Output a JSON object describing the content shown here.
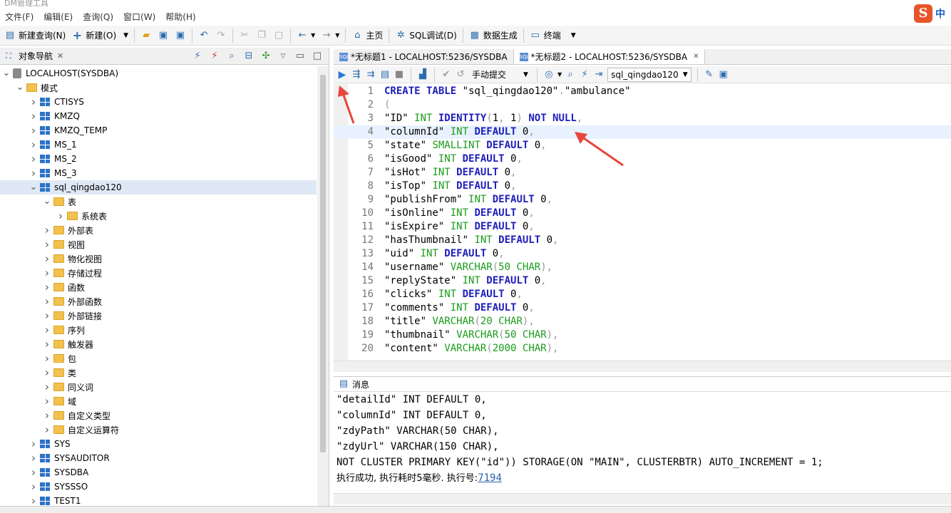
{
  "app": {
    "title": "DM管理工具"
  },
  "menu": [
    "文件(F)",
    "编辑(E)",
    "查询(Q)",
    "窗口(W)",
    "帮助(H)"
  ],
  "ime": {
    "logo": "S",
    "lang": "中"
  },
  "toolbar": {
    "new_query": "新建查询(N)",
    "new": "新建(O)",
    "home": "主页",
    "sql_debug": "SQL调试(D)",
    "data_gen": "数据生成",
    "terminal": "终端"
  },
  "navigator": {
    "title": "对象导航",
    "tree": [
      {
        "label": "LOCALHOST(SYSDBA)",
        "level": 0,
        "icon": "server-icon",
        "expanded": true
      },
      {
        "label": "模式",
        "level": 1,
        "icon": "folder-icon",
        "expanded": true
      },
      {
        "label": "CTISYS",
        "level": 2,
        "icon": "schema-icon",
        "expanded": false
      },
      {
        "label": "KMZQ",
        "level": 2,
        "icon": "schema-icon",
        "expanded": false
      },
      {
        "label": "KMZQ_TEMP",
        "level": 2,
        "icon": "schema-icon",
        "expanded": false
      },
      {
        "label": "MS_1",
        "level": 2,
        "icon": "schema-icon",
        "expanded": false
      },
      {
        "label": "MS_2",
        "level": 2,
        "icon": "schema-icon",
        "expanded": false
      },
      {
        "label": "MS_3",
        "level": 2,
        "icon": "schema-icon",
        "expanded": false
      },
      {
        "label": "sql_qingdao120",
        "level": 2,
        "icon": "schema-icon",
        "expanded": true,
        "selected": true
      },
      {
        "label": "表",
        "level": 3,
        "icon": "folder-icon",
        "expanded": true
      },
      {
        "label": "系统表",
        "level": 4,
        "icon": "folder-icon",
        "expanded": false
      },
      {
        "label": "外部表",
        "level": 3,
        "icon": "folder-icon",
        "expanded": false
      },
      {
        "label": "视图",
        "level": 3,
        "icon": "folder-icon",
        "expanded": false
      },
      {
        "label": "物化视图",
        "level": 3,
        "icon": "folder-icon",
        "expanded": false
      },
      {
        "label": "存储过程",
        "level": 3,
        "icon": "folder-icon",
        "expanded": false
      },
      {
        "label": "函数",
        "level": 3,
        "icon": "folder-icon",
        "expanded": false
      },
      {
        "label": "外部函数",
        "level": 3,
        "icon": "folder-icon",
        "expanded": false
      },
      {
        "label": "外部链接",
        "level": 3,
        "icon": "folder-icon",
        "expanded": false
      },
      {
        "label": "序列",
        "level": 3,
        "icon": "folder-icon",
        "expanded": false
      },
      {
        "label": "触发器",
        "level": 3,
        "icon": "folder-icon",
        "expanded": false
      },
      {
        "label": "包",
        "level": 3,
        "icon": "folder-icon",
        "expanded": false
      },
      {
        "label": "类",
        "level": 3,
        "icon": "folder-icon",
        "expanded": false
      },
      {
        "label": "同义词",
        "level": 3,
        "icon": "folder-icon",
        "expanded": false
      },
      {
        "label": "域",
        "level": 3,
        "icon": "folder-icon",
        "expanded": false
      },
      {
        "label": "自定义类型",
        "level": 3,
        "icon": "folder-icon",
        "expanded": false
      },
      {
        "label": "自定义运算符",
        "level": 3,
        "icon": "folder-icon",
        "expanded": false
      },
      {
        "label": "SYS",
        "level": 2,
        "icon": "schema-icon",
        "expanded": false
      },
      {
        "label": "SYSAUDITOR",
        "level": 2,
        "icon": "schema-icon",
        "expanded": false
      },
      {
        "label": "SYSDBA",
        "level": 2,
        "icon": "schema-icon",
        "expanded": false
      },
      {
        "label": "SYSSSO",
        "level": 2,
        "icon": "schema-icon",
        "expanded": false
      },
      {
        "label": "TEST1",
        "level": 2,
        "icon": "schema-icon",
        "expanded": false
      }
    ]
  },
  "tabs": [
    {
      "label": "*无标题1 - LOCALHOST:5236/SYSDBA",
      "active": false
    },
    {
      "label": "*无标题2 - LOCALHOST:5236/SYSDBA",
      "active": true
    }
  ],
  "editor_toolbar": {
    "commit_mode": "手动提交",
    "schema": "sql_qingdao120"
  },
  "editor": {
    "current_line": 4,
    "lines": [
      {
        "n": "1",
        "parts": [
          [
            "kw",
            "CREATE TABLE "
          ],
          [
            "tx",
            "\"sql_qingdao120\""
          ],
          [
            "pu",
            "."
          ],
          [
            "tx",
            "\"ambulance\""
          ]
        ]
      },
      {
        "n": "2",
        "parts": [
          [
            "pu",
            "("
          ]
        ]
      },
      {
        "n": "3",
        "parts": [
          [
            "tx",
            "\"ID\" "
          ],
          [
            "ty",
            "INT "
          ],
          [
            "kw",
            "IDENTITY"
          ],
          [
            "pu",
            "("
          ],
          [
            "tx",
            "1"
          ],
          [
            "pu",
            ", "
          ],
          [
            "tx",
            "1"
          ],
          [
            "pu",
            ") "
          ],
          [
            "kw",
            "NOT NULL"
          ],
          [
            "pu",
            ","
          ]
        ]
      },
      {
        "n": "4",
        "parts": [
          [
            "tx",
            "\"columnId\" "
          ],
          [
            "ty",
            "INT "
          ],
          [
            "kw",
            "DEFAULT "
          ],
          [
            "tx",
            "0"
          ],
          [
            "pu",
            ","
          ]
        ]
      },
      {
        "n": "5",
        "parts": [
          [
            "tx",
            "\"state\" "
          ],
          [
            "ty",
            "SMALLINT "
          ],
          [
            "kw",
            "DEFAULT "
          ],
          [
            "tx",
            "0"
          ],
          [
            "pu",
            ","
          ]
        ]
      },
      {
        "n": "6",
        "parts": [
          [
            "tx",
            "\"isGood\" "
          ],
          [
            "ty",
            "INT "
          ],
          [
            "kw",
            "DEFAULT "
          ],
          [
            "tx",
            "0"
          ],
          [
            "pu",
            ","
          ]
        ]
      },
      {
        "n": "7",
        "parts": [
          [
            "tx",
            "\"isHot\" "
          ],
          [
            "ty",
            "INT "
          ],
          [
            "kw",
            "DEFAULT "
          ],
          [
            "tx",
            "0"
          ],
          [
            "pu",
            ","
          ]
        ]
      },
      {
        "n": "8",
        "parts": [
          [
            "tx",
            "\"isTop\" "
          ],
          [
            "ty",
            "INT "
          ],
          [
            "kw",
            "DEFAULT "
          ],
          [
            "tx",
            "0"
          ],
          [
            "pu",
            ","
          ]
        ]
      },
      {
        "n": "9",
        "parts": [
          [
            "tx",
            "\"publishFrom\" "
          ],
          [
            "ty",
            "INT "
          ],
          [
            "kw",
            "DEFAULT "
          ],
          [
            "tx",
            "0"
          ],
          [
            "pu",
            ","
          ]
        ]
      },
      {
        "n": "10",
        "parts": [
          [
            "tx",
            "\"isOnline\" "
          ],
          [
            "ty",
            "INT "
          ],
          [
            "kw",
            "DEFAULT "
          ],
          [
            "tx",
            "0"
          ],
          [
            "pu",
            ","
          ]
        ]
      },
      {
        "n": "11",
        "parts": [
          [
            "tx",
            "\"isExpire\" "
          ],
          [
            "ty",
            "INT "
          ],
          [
            "kw",
            "DEFAULT "
          ],
          [
            "tx",
            "0"
          ],
          [
            "pu",
            ","
          ]
        ]
      },
      {
        "n": "12",
        "parts": [
          [
            "tx",
            "\"hasThumbnail\" "
          ],
          [
            "ty",
            "INT "
          ],
          [
            "kw",
            "DEFAULT "
          ],
          [
            "tx",
            "0"
          ],
          [
            "pu",
            ","
          ]
        ]
      },
      {
        "n": "13",
        "parts": [
          [
            "tx",
            "\"uid\" "
          ],
          [
            "ty",
            "INT "
          ],
          [
            "kw",
            "DEFAULT "
          ],
          [
            "tx",
            "0"
          ],
          [
            "pu",
            ","
          ]
        ]
      },
      {
        "n": "14",
        "parts": [
          [
            "tx",
            "\"username\" "
          ],
          [
            "ty",
            "VARCHAR"
          ],
          [
            "pu",
            "("
          ],
          [
            "ty",
            "50 CHAR"
          ],
          [
            "pu",
            "),"
          ]
        ]
      },
      {
        "n": "15",
        "parts": [
          [
            "tx",
            "\"replyState\" "
          ],
          [
            "ty",
            "INT "
          ],
          [
            "kw",
            "DEFAULT "
          ],
          [
            "tx",
            "0"
          ],
          [
            "pu",
            ","
          ]
        ]
      },
      {
        "n": "16",
        "parts": [
          [
            "tx",
            "\"clicks\" "
          ],
          [
            "ty",
            "INT "
          ],
          [
            "kw",
            "DEFAULT "
          ],
          [
            "tx",
            "0"
          ],
          [
            "pu",
            ","
          ]
        ]
      },
      {
        "n": "17",
        "parts": [
          [
            "tx",
            "\"comments\" "
          ],
          [
            "ty",
            "INT "
          ],
          [
            "kw",
            "DEFAULT "
          ],
          [
            "tx",
            "0"
          ],
          [
            "pu",
            ","
          ]
        ]
      },
      {
        "n": "18",
        "parts": [
          [
            "tx",
            "\"title\" "
          ],
          [
            "ty",
            "VARCHAR"
          ],
          [
            "pu",
            "("
          ],
          [
            "ty",
            "20 CHAR"
          ],
          [
            "pu",
            "),"
          ]
        ]
      },
      {
        "n": "19",
        "parts": [
          [
            "tx",
            "\"thumbnail\" "
          ],
          [
            "ty",
            "VARCHAR"
          ],
          [
            "pu",
            "("
          ],
          [
            "ty",
            "50 CHAR"
          ],
          [
            "pu",
            "),"
          ]
        ]
      },
      {
        "n": "20",
        "parts": [
          [
            "tx",
            "\"content\" "
          ],
          [
            "ty",
            "VARCHAR"
          ],
          [
            "pu",
            "("
          ],
          [
            "ty",
            "2000 CHAR"
          ],
          [
            "pu",
            "),"
          ]
        ]
      }
    ]
  },
  "messages": {
    "title": "消息",
    "lines": [
      "\"detailId\" INT DEFAULT 0,",
      "\"columnId\" INT DEFAULT 0,",
      "\"zdyPath\" VARCHAR(50 CHAR),",
      "\"zdyUrl\" VARCHAR(150 CHAR),",
      "NOT CLUSTER PRIMARY KEY(\"id\")) STORAGE(ON \"MAIN\", CLUSTERBTR) AUTO_INCREMENT = 1;"
    ],
    "result_prefix": "执行成功, 执行耗时5毫秒. 执行号:",
    "exec_no": "7194"
  },
  "colors": {
    "keyword": "#1d1dbb",
    "type": "#1a9c1a",
    "annotation_arrow": "#e8453c",
    "selection": "#dfe8f5"
  }
}
